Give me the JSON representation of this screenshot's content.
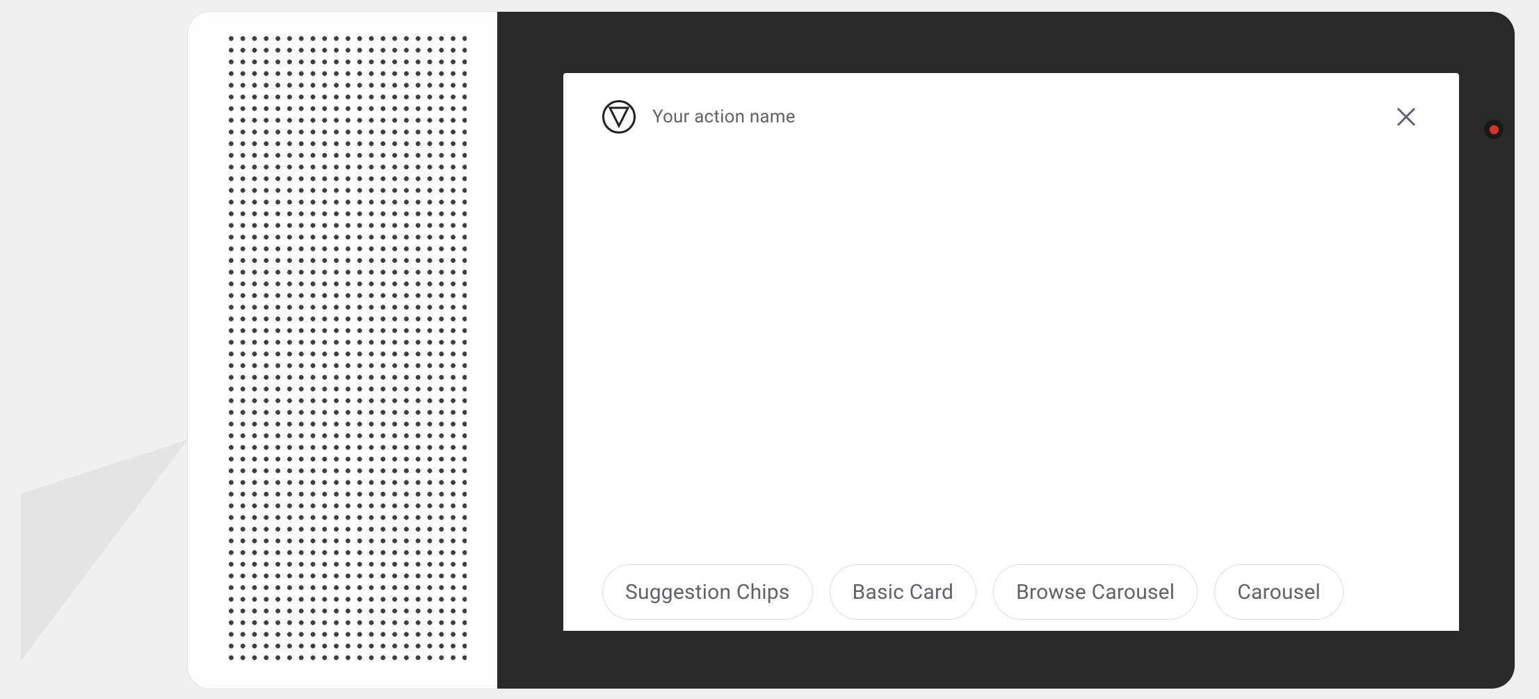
{
  "header": {
    "action_name": "Your action name"
  },
  "chips": [
    {
      "label": "Suggestion Chips"
    },
    {
      "label": "Basic Card"
    },
    {
      "label": "Browse Carousel"
    },
    {
      "label": "Carousel"
    }
  ]
}
